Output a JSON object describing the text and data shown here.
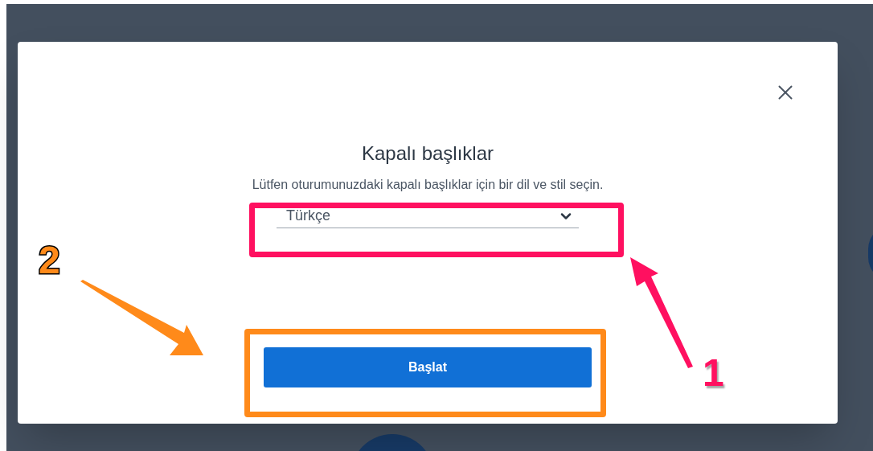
{
  "dialog": {
    "title": "Kapalı başlıklar",
    "description": "Lütfen oturumunuzdaki kapalı başlıklar için bir dil ve stil seçin.",
    "language_select": {
      "value": "Türkçe"
    },
    "start_button": "Başlat"
  },
  "annotations": [
    {
      "label": "1",
      "color": "#ff1060"
    },
    {
      "label": "2",
      "color": "#ff8a1a"
    }
  ]
}
